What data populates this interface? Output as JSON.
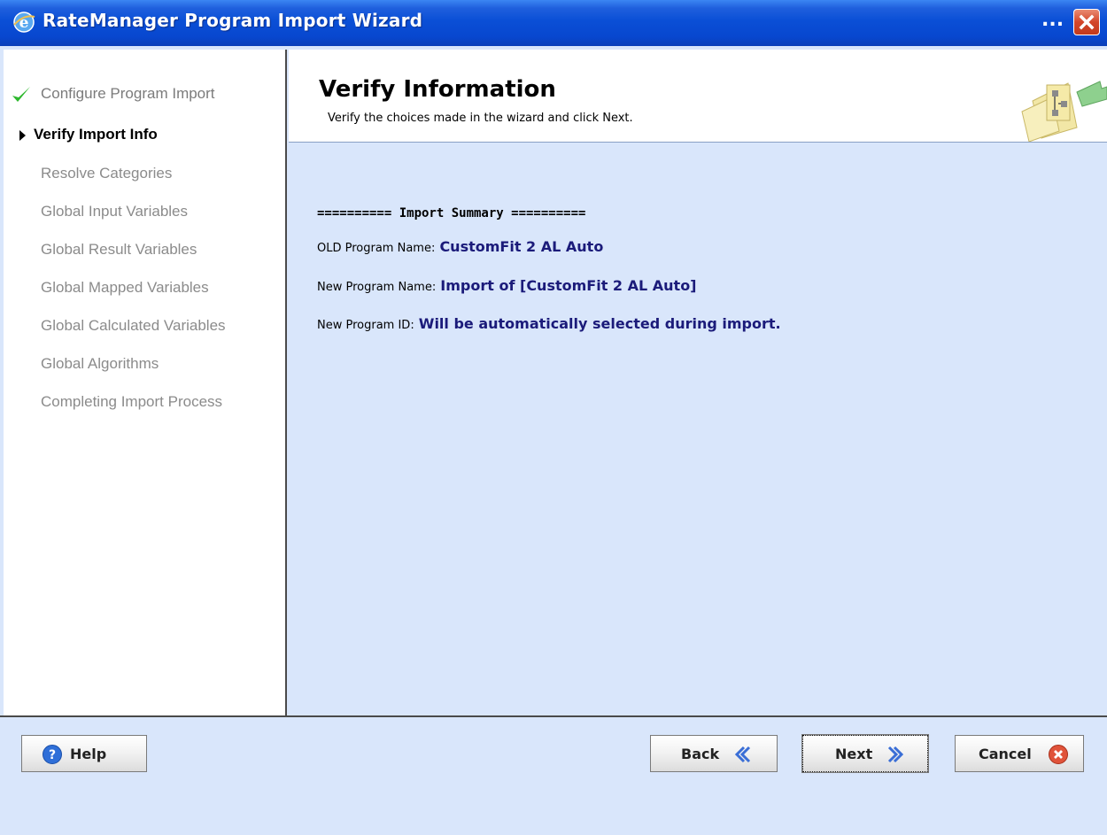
{
  "window": {
    "title": "RateManager Program Import Wizard",
    "overflow_label": "...",
    "colors": {
      "titlebar": "#0a4fd6",
      "content_bg": "#d9e6fb",
      "value_text": "#1b1b7a",
      "check": "#2eb82e",
      "close": "#d3462a"
    }
  },
  "nav": {
    "items": [
      {
        "label": "Configure Program Import",
        "state": "done",
        "icon": "checkmark-icon"
      },
      {
        "label": "Verify Import Info",
        "state": "current",
        "icon": "arrow-right-icon"
      },
      {
        "label": "Resolve Categories",
        "state": "pending"
      },
      {
        "label": "Global Input Variables",
        "state": "pending"
      },
      {
        "label": "Global Result Variables",
        "state": "pending"
      },
      {
        "label": "Global Mapped Variables",
        "state": "pending"
      },
      {
        "label": "Global Calculated Variables",
        "state": "pending"
      },
      {
        "label": "Global Algorithms",
        "state": "pending"
      },
      {
        "label": "Completing Import Process",
        "state": "pending"
      }
    ]
  },
  "header": {
    "title": "Verify Information",
    "subtitle": "Verify the choices made in the wizard and click Next.",
    "icon": "wizard-flowchart-icon"
  },
  "summary": {
    "heading": "========== Import Summary ==========",
    "rows": [
      {
        "label": "OLD Program Name:",
        "value": "CustomFit 2 AL Auto"
      },
      {
        "label": "New Program Name:",
        "value": "Import of [CustomFit 2 AL Auto]"
      },
      {
        "label": "New Program ID:",
        "value": "Will be automatically selected during import."
      }
    ]
  },
  "footer": {
    "help_label": "Help",
    "back_label": "Back",
    "next_label": "Next",
    "cancel_label": "Cancel"
  }
}
